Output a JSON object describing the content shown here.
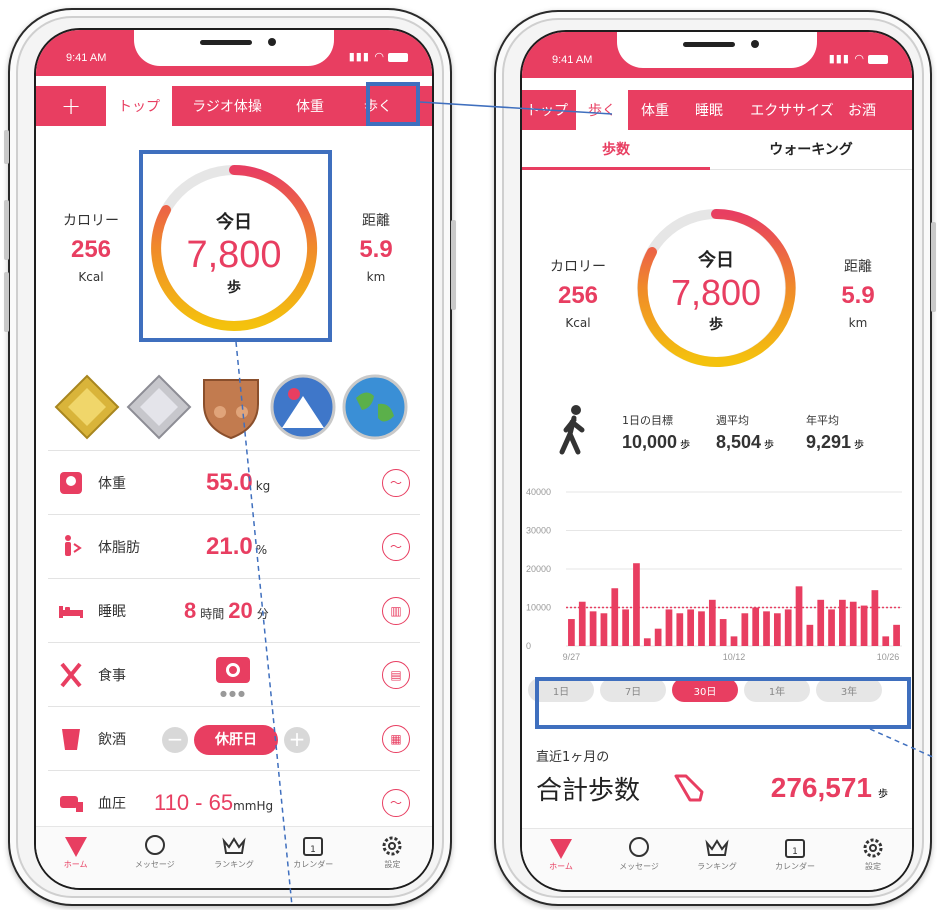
{
  "colors": {
    "accent": "#e83e61",
    "highlight": "#3f6fbe",
    "ringStart": "#e83e61",
    "ringEnd": "#f4c20d"
  },
  "status_time": "9:41 AM",
  "left": {
    "tabs": [
      "+",
      "トップ",
      "ラジオ体操",
      "体重",
      "歩く"
    ],
    "calorie_label": "カロリー",
    "calorie_value": "256",
    "calorie_unit": "Kcal",
    "distance_label": "距離",
    "distance_value": "5.9",
    "distance_unit": "km",
    "today_label": "今日",
    "steps_value": "7,800",
    "steps_unit": "歩",
    "badges": [
      "gold-diamond-badge",
      "silver-diamond-badge",
      "bronze-shield-badge",
      "mountain-badge",
      "earth-globe-badge"
    ],
    "rows": [
      {
        "label": "体重",
        "value": "55.0",
        "unit": "kg",
        "icon": "scale-icon"
      },
      {
        "label": "体脂肪",
        "value": "21.0",
        "unit": "%",
        "icon": "body-fat-icon"
      },
      {
        "label": "睡眠",
        "value_h": "8",
        "unit_h": "時間",
        "value_m": "20",
        "unit_m": "分",
        "icon": "bed-icon"
      },
      {
        "label": "食事",
        "icon": "fork-knife-icon"
      },
      {
        "label": "飲酒",
        "button": "休肝日",
        "icon": "glass-icon"
      },
      {
        "label": "血圧",
        "value": "110 - 65",
        "unit": "mmHg",
        "icon": "blood-pressure-icon"
      }
    ]
  },
  "right": {
    "tabs": [
      "トップ",
      "歩く",
      "体重",
      "睡眠",
      "エクササイズ",
      "お酒"
    ],
    "subtabs": [
      "歩数",
      "ウォーキング"
    ],
    "calorie_label": "カロリー",
    "calorie_value": "256",
    "calorie_unit": "Kcal",
    "distance_label": "距離",
    "distance_value": "5.9",
    "distance_unit": "km",
    "today_label": "今日",
    "steps_value": "7,800",
    "steps_unit": "歩",
    "goal_label": "1日の目標",
    "goal_value": "10,000",
    "week_label": "週平均",
    "week_value": "8,504",
    "year_label": "年平均",
    "year_value": "9,291",
    "step_unit": "歩",
    "periods": [
      "1日",
      "7日",
      "30日",
      "1年",
      "3年"
    ],
    "period_selected": "30日",
    "recent_label": "直近1ヶ月の",
    "total_label": "合計歩数",
    "total_value": "276,571",
    "total_unit": "歩"
  },
  "nav": [
    "ホーム",
    "メッセージ",
    "ランキング",
    "カレンダー",
    "設定"
  ],
  "chart_data": {
    "type": "bar",
    "y_ticks": [
      "40000",
      "30000",
      "20000",
      "10000",
      "0"
    ],
    "x_labels": [
      "9/27",
      "10/12",
      "10/26"
    ],
    "ylim": [
      0,
      40000
    ],
    "goal_line": 10000,
    "values": [
      7000,
      11500,
      9000,
      8500,
      15000,
      9500,
      21500,
      2000,
      4500,
      9500,
      8500,
      9500,
      9000,
      12000,
      7000,
      2500,
      8500,
      10000,
      9000,
      8500,
      9500,
      15500,
      5500,
      12000,
      9500,
      12000,
      11500,
      10500,
      14500,
      2500,
      5500
    ]
  }
}
